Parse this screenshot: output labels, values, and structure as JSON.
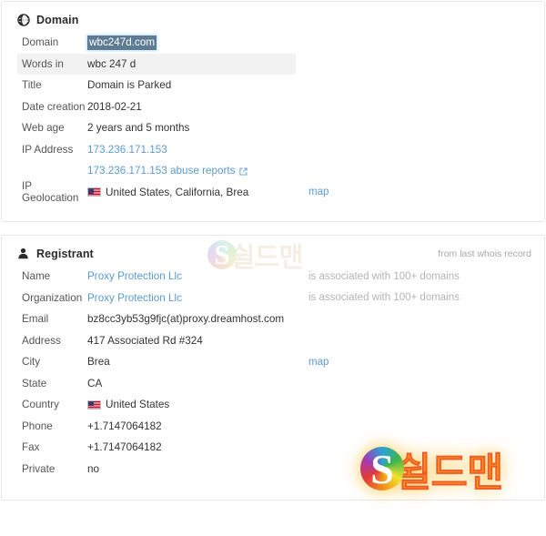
{
  "domain_panel": {
    "icon": "globe-icon",
    "title": "Domain",
    "rows": [
      {
        "label": "Domain",
        "value": "wbc247d.com",
        "style": "selected"
      },
      {
        "label": "Words in",
        "value": "wbc 247 d",
        "style": "striped"
      },
      {
        "label": "Title",
        "value": "Domain is Parked",
        "style": "plain"
      },
      {
        "label": "Date creation",
        "value": "2018-02-21",
        "style": "plain"
      },
      {
        "label": "Web age",
        "value": "2 years and 5 months",
        "style": "plain"
      },
      {
        "label": "IP Address",
        "value": "173.236.171.153",
        "style": "link"
      },
      {
        "label": "",
        "value": "173.236.171.153 abuse reports",
        "style": "link-ext",
        "icon": "external-link-icon"
      },
      {
        "label": "IP Geolocation",
        "value": "United States, California, Brea",
        "style": "flag",
        "flag_icon": "us-flag-icon",
        "aside_link": "map"
      }
    ]
  },
  "registrant_panel": {
    "icon": "user-icon",
    "title": "Registrant",
    "note": "from last whois record",
    "rows": [
      {
        "label": "Name",
        "value": "Proxy Protection Llc",
        "style": "link",
        "aside": "is associated with 100+ domains"
      },
      {
        "label": "Organization",
        "value": "Proxy Protection Llc",
        "style": "link",
        "aside": "is associated with 100+ domains"
      },
      {
        "label": "Email",
        "value": "bz8cc3yb53g9fjc(at)proxy.dreamhost.com",
        "style": "plain"
      },
      {
        "label": "Address",
        "value": "417 Associated Rd #324",
        "style": "plain"
      },
      {
        "label": "City",
        "value": "Brea",
        "style": "plain",
        "aside_link": "map"
      },
      {
        "label": "State",
        "value": "CA",
        "style": "plain"
      },
      {
        "label": "Country",
        "value": "United States",
        "style": "flag",
        "flag_icon": "us-flag-icon"
      },
      {
        "label": "Phone",
        "value": "+1.7147064182",
        "style": "plain"
      },
      {
        "label": "Fax",
        "value": "+1.7147064182",
        "style": "plain"
      },
      {
        "label": "Private",
        "value": "no",
        "style": "plain"
      }
    ]
  },
  "watermarks": {
    "top": {
      "logo_letter": "S",
      "text": "쉴드맨"
    },
    "bottom": {
      "logo_letter": "S",
      "text": "쉴드맨"
    }
  },
  "colors": {
    "link": "#5b9bd1",
    "selection_bg": "#5d7c93",
    "stripe_bg": "#f2f2f2",
    "label_text": "#555555",
    "value_text": "#333333",
    "muted_text": "#b4b4b4",
    "card_border": "#e6e6e6"
  }
}
